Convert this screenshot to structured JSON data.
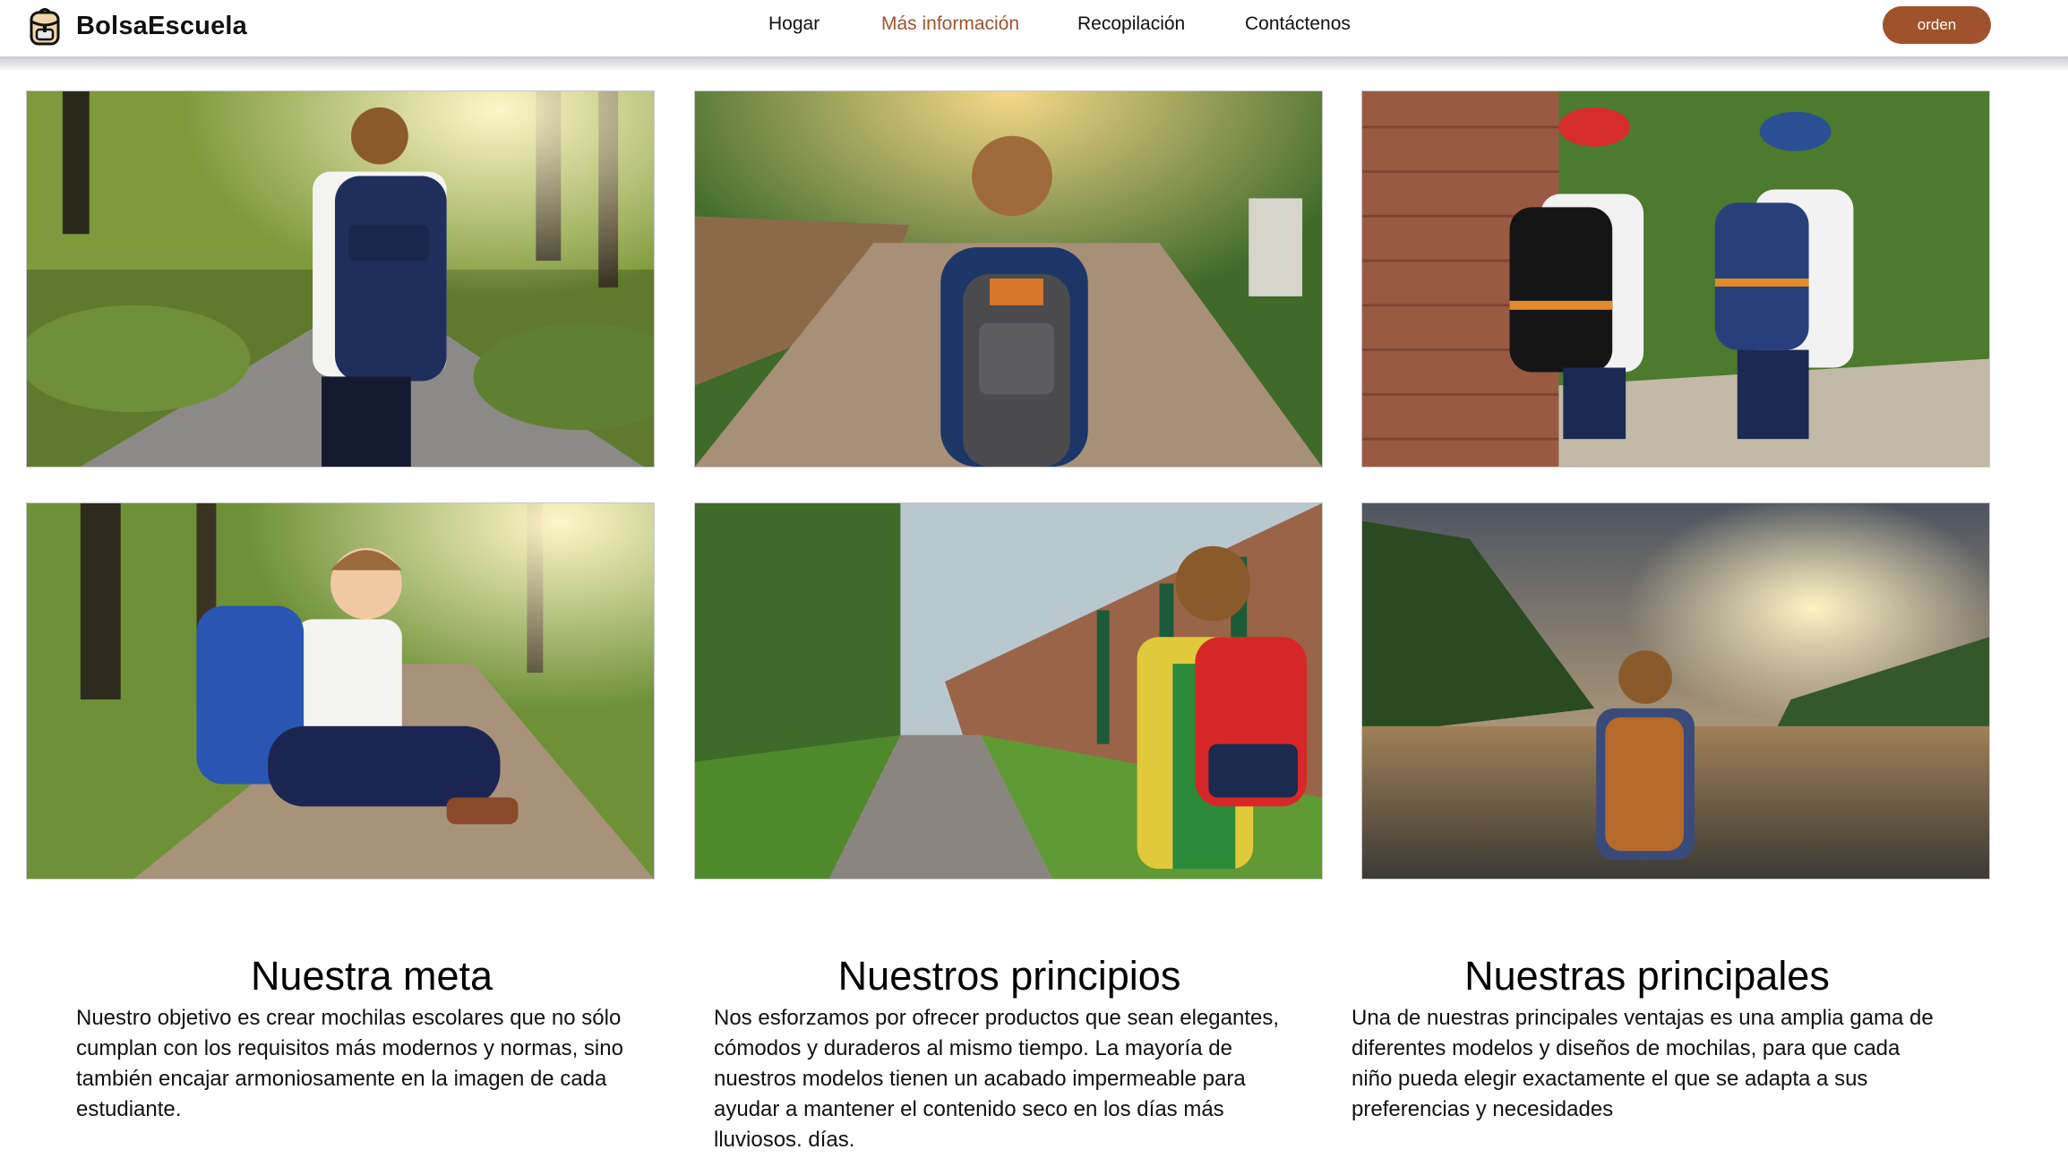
{
  "brand": {
    "name": "BolsaEscuela",
    "logo_icon": "backpack-icon"
  },
  "nav": {
    "items": [
      {
        "label": "Hogar",
        "active": false
      },
      {
        "label": "Más información",
        "active": true
      },
      {
        "label": "Recopilación",
        "active": false
      },
      {
        "label": "Contáctenos",
        "active": false
      }
    ]
  },
  "order_button": {
    "label": "orden"
  },
  "colors": {
    "accent": "#a0522d",
    "text": "#111111",
    "background": "#ffffff"
  },
  "gallery": [
    {
      "name": "boy-navy-backpack-park-path"
    },
    {
      "name": "boy-grey-backpack-brick-road"
    },
    {
      "name": "two-boys-caps-backpacks"
    },
    {
      "name": "smiling-boy-sitting-blue-backpack"
    },
    {
      "name": "boy-red-backpack-street"
    },
    {
      "name": "boy-brown-backpack-river-sunset"
    }
  ],
  "sections": [
    {
      "title": "Nuestra meta",
      "text": "Nuestro objetivo es crear mochilas escolares que no sólo cumplan con los requisitos más modernos y normas, sino también encajar armoniosamente en la imagen de cada estudiante."
    },
    {
      "title": "Nuestros principios",
      "text": "Nos esforzamos por ofrecer productos que sean elegantes, cómodos y duraderos al mismo tiempo. La mayoría de nuestros modelos tienen un acabado impermeable para ayudar a mantener el contenido seco en los días más lluviosos. días."
    },
    {
      "title": "Nuestras principales",
      "text": "Una de nuestras principales ventajas es una amplia gama de diferentes modelos y diseños de mochilas, para que cada niño pueda elegir exactamente el que se adapta a sus preferencias y necesidades"
    }
  ]
}
